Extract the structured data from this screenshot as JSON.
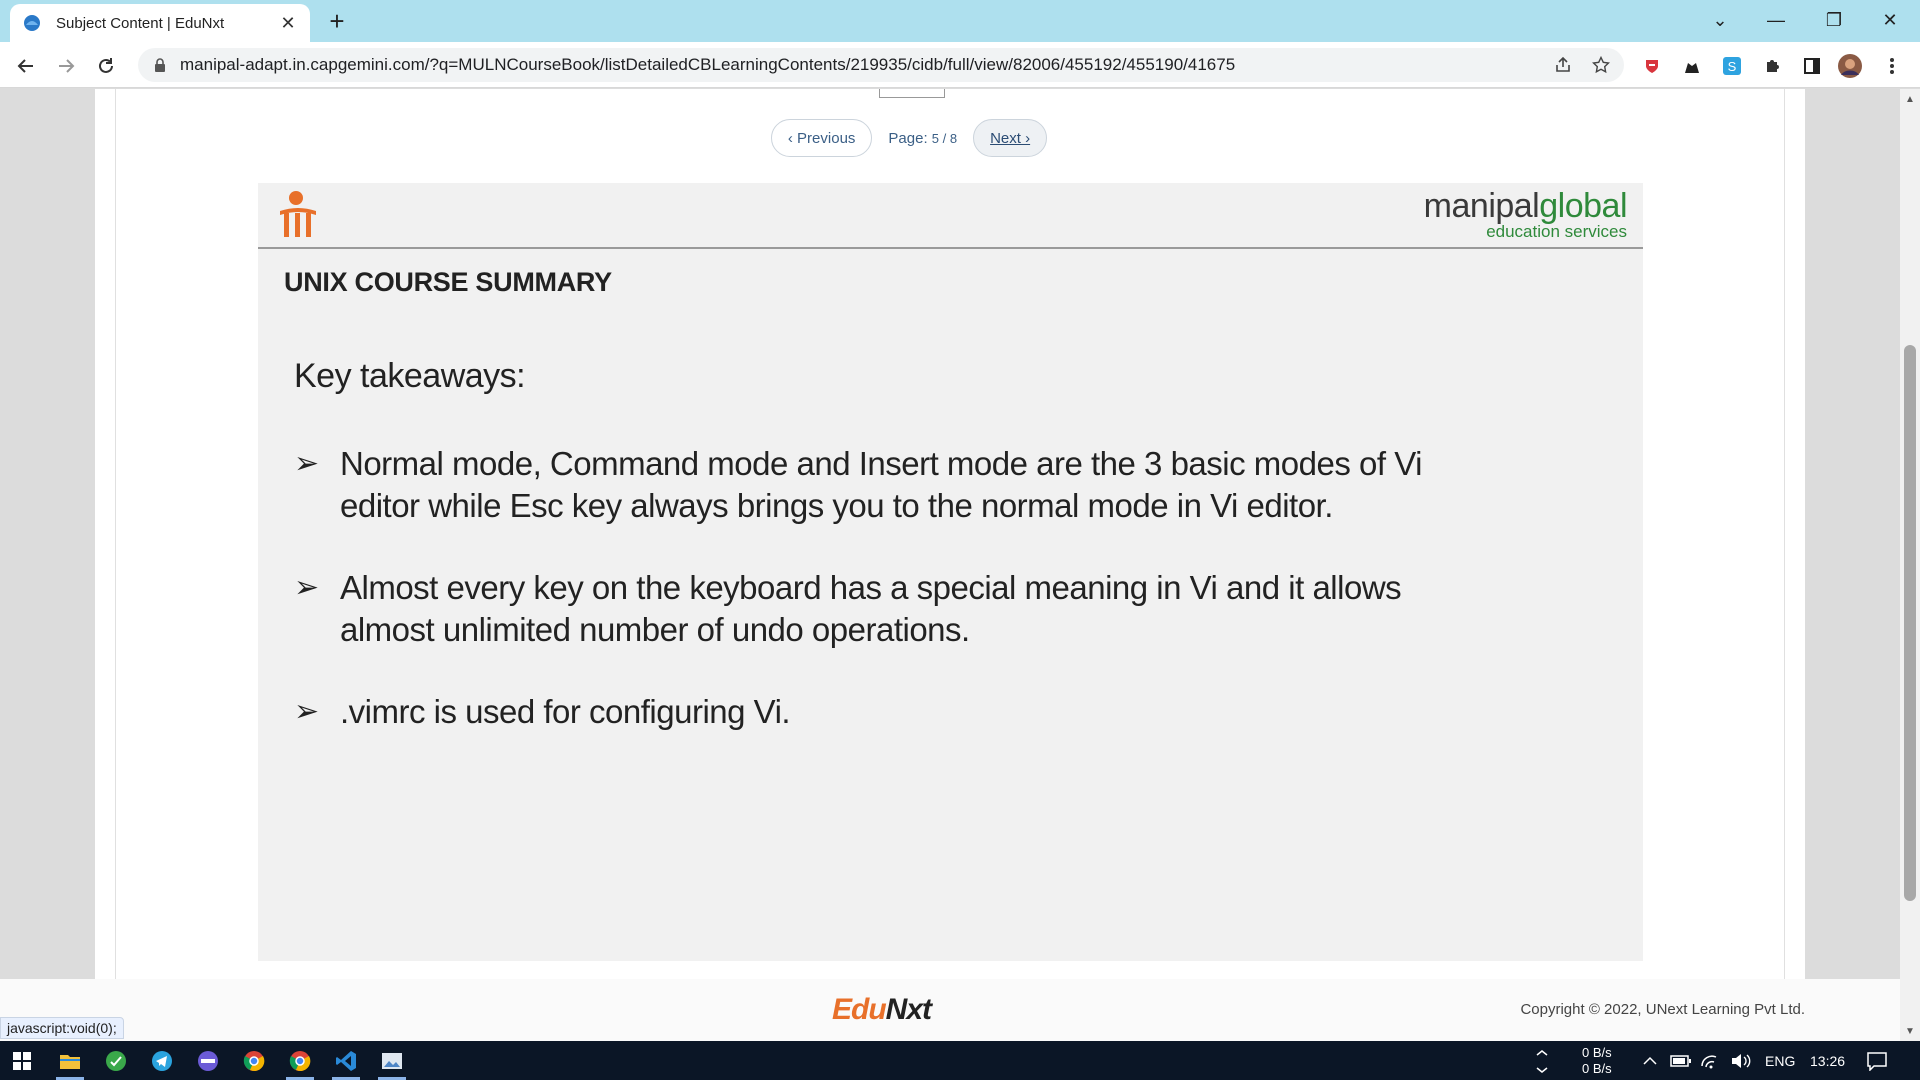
{
  "browser": {
    "tab_title": "Subject Content | EduNxt",
    "url": "manipal-adapt.in.capgemini.com/?q=MULNCourseBook/listDetailedCBLearningContents/219935/cidb/full/view/82006/455192/455190/41675",
    "new_tab_symbol": "+",
    "tab_close_symbol": "✕",
    "window_controls": {
      "minimize": "—",
      "restore": "❐",
      "close": "✕",
      "tab_search": "⌄"
    }
  },
  "pager": {
    "previous_label": "‹ Previous",
    "page_prefix": "Page:",
    "page_value": "5 / 8",
    "next_label": "Next ›"
  },
  "slide": {
    "brand_dark": "manipal",
    "brand_green": "global",
    "brand_sub": "education services",
    "title": "UNIX COURSE SUMMARY",
    "subtitle": "Key takeaways:",
    "bullets": [
      {
        "arrow": "➢",
        "text": "Normal mode, Command mode and Insert mode are the 3 basic modes of Vi editor while Esc key always brings you to the normal mode in Vi editor."
      },
      {
        "arrow": "➢",
        "text": "Almost every key on the keyboard has a special meaning in Vi and it allows almost unlimited number of undo operations."
      },
      {
        "arrow": "➢",
        "text": ".vimrc is used for configuring Vi."
      }
    ]
  },
  "footer": {
    "logo_part1": "Edu",
    "logo_part2": "Nxt",
    "copyright": "Copyright © 2022, UNext Learning Pvt Ltd.",
    "status_text": "javascript:void(0);"
  },
  "taskbar": {
    "net_up": "0 B/s",
    "net_down": "0 B/s",
    "language": "ENG",
    "time": "13:26"
  },
  "colors": {
    "tabbar_bg": "#aee0ee",
    "brand_green": "#2f8a3b",
    "edunxt_orange": "#e8702a",
    "taskbar_bg": "#0b1626"
  }
}
